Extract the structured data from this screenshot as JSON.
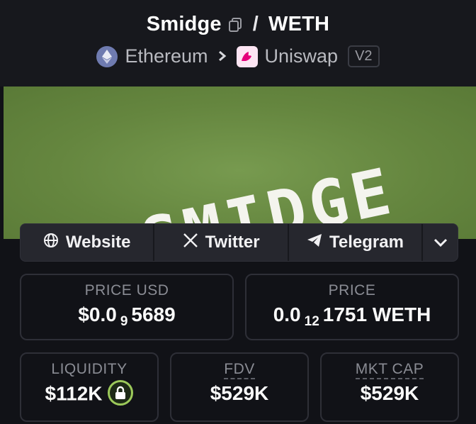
{
  "header": {
    "token": "Smidge",
    "separator": "/",
    "quote": "WETH",
    "chain": "Ethereum",
    "dex": "Uniswap",
    "version": "V2"
  },
  "banner": {
    "text": "SMIDGE",
    "background": "#6a8a45"
  },
  "links": {
    "website": "Website",
    "twitter": "Twitter",
    "telegram": "Telegram"
  },
  "stats": {
    "price_usd_label": "PRICE USD",
    "price_usd_prefix": "$0.0",
    "price_usd_zeros": "9",
    "price_usd_digits": "5689",
    "price_label": "PRICE",
    "price_prefix": "0.0",
    "price_zeros": "12",
    "price_digits": "1751",
    "price_unit": "WETH",
    "liquidity_label": "LIQUIDITY",
    "liquidity_value": "$112K",
    "fdv_label": "FDV",
    "fdv_value": "$529K",
    "mcap_label": "MKT CAP",
    "mcap_value": "$529K"
  },
  "icons": {
    "copy": "copy-icon",
    "chain": "ethereum-icon",
    "dex": "uniswap-icon",
    "website": "globe-icon",
    "twitter": "x-icon",
    "telegram": "telegram-icon",
    "more": "chevron-down-icon",
    "liquidity": "lock-icon"
  },
  "colors": {
    "background": "#111217",
    "card_border": "#2e2f37",
    "lock_accent": "#9cc95a"
  }
}
